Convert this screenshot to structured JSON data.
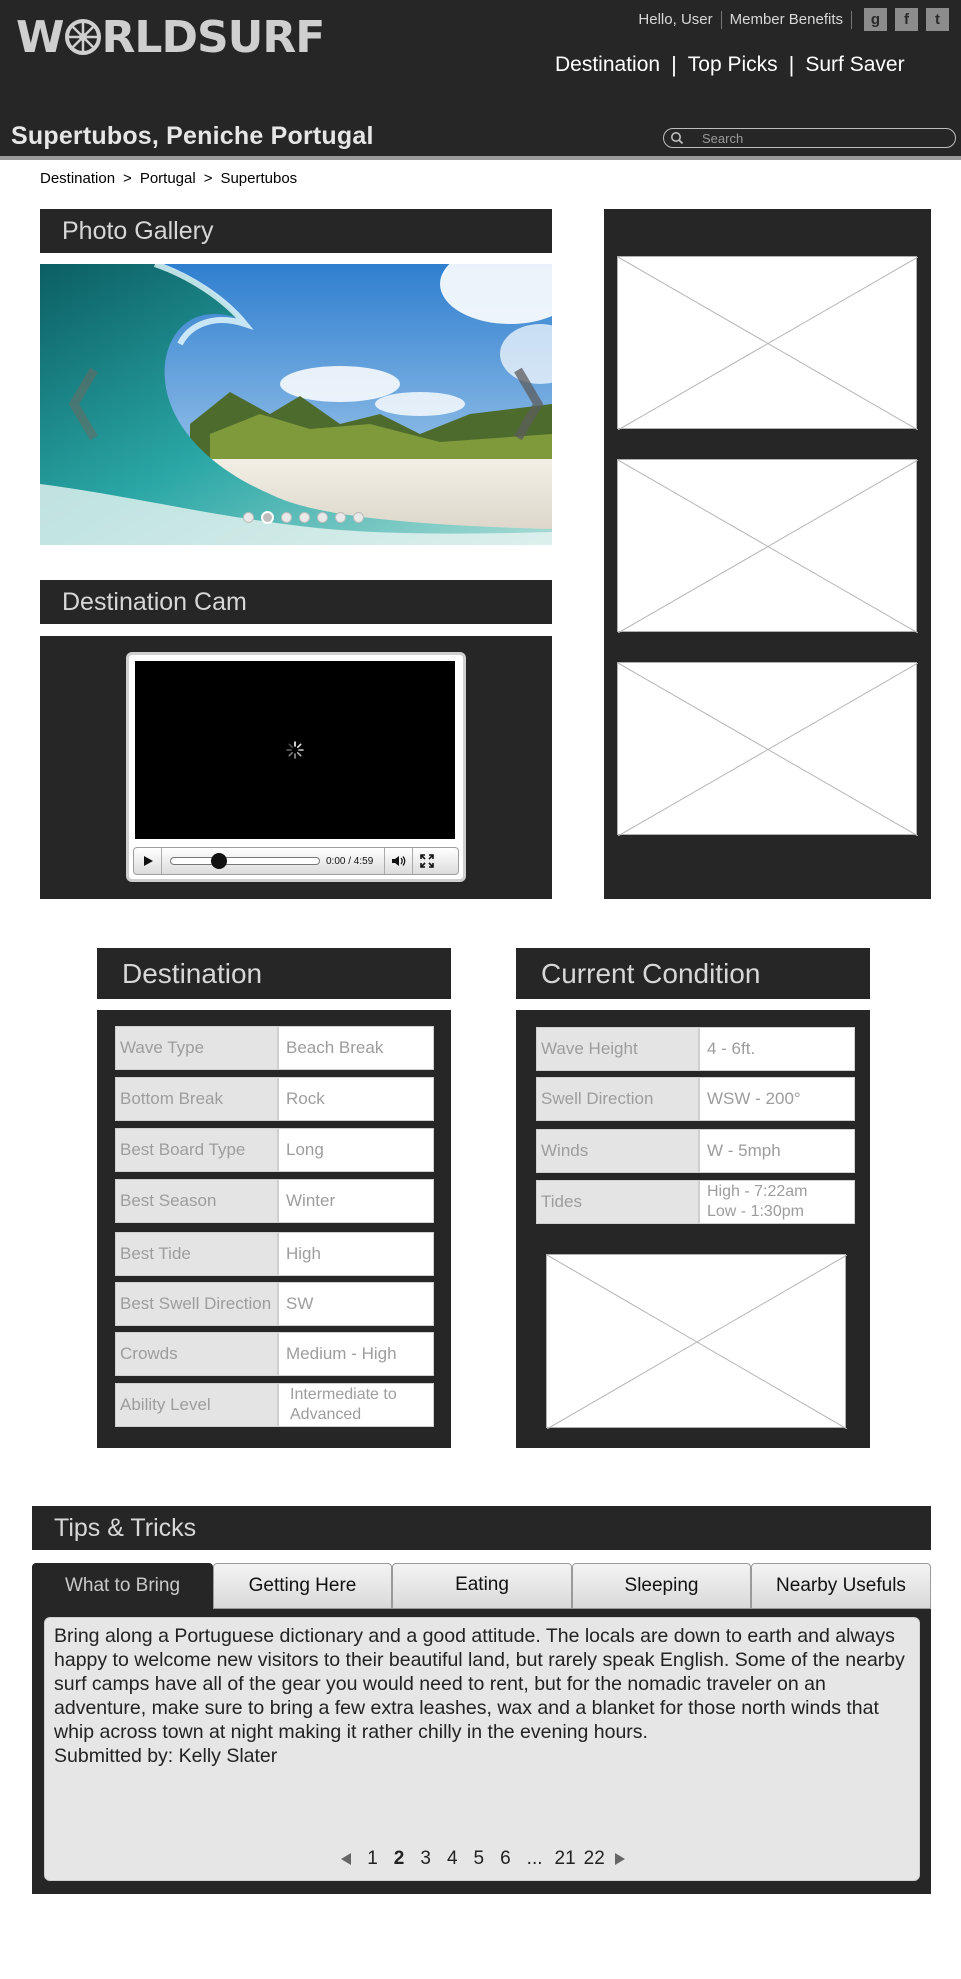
{
  "header": {
    "logo_text_left": "W",
    "logo_text_right": "RLDSURF",
    "greeting": "Hello, User",
    "member_benefits": "Member Benefits",
    "social": [
      "g",
      "f",
      "t"
    ],
    "nav": [
      "Destination",
      "Top Picks",
      "Surf Saver"
    ],
    "page_title": "Supertubos, Peniche Portugal",
    "search_placeholder": "Search"
  },
  "breadcrumb": [
    "Destination",
    ">",
    "Portugal",
    ">",
    "Supertubos"
  ],
  "gallery": {
    "title": "Photo Gallery",
    "dot_count": 7,
    "active_dot": 2
  },
  "cam": {
    "title": "Destination Cam",
    "time": "0:00 / 4:59"
  },
  "destination": {
    "title": "Destination",
    "rows": [
      {
        "label": "Wave Type",
        "value": "Beach Break"
      },
      {
        "label": "Bottom Break",
        "value": "Rock"
      },
      {
        "label": "Best Board Type",
        "value": "Long"
      },
      {
        "label": "Best Season",
        "value": "Winter"
      },
      {
        "label": "Best Tide",
        "value": "High"
      },
      {
        "label": "Best Swell Direction",
        "value": "SW"
      },
      {
        "label": "Crowds",
        "value": "Medium - High"
      },
      {
        "label": "Ability Level",
        "value": "Intermediate to Advanced"
      }
    ]
  },
  "conditions": {
    "title": "Current Condition",
    "rows": [
      {
        "label": "Wave Height",
        "value": "4 - 6ft."
      },
      {
        "label": "Swell Direction",
        "value": "WSW - 200°"
      },
      {
        "label": "Winds",
        "value": "W - 5mph"
      },
      {
        "label": "Tides",
        "value": "High - 7:22am\nLow - 1:30pm"
      }
    ]
  },
  "tips": {
    "title": "Tips & Tricks",
    "tabs": [
      "What to Bring",
      "Getting Here",
      "Eating",
      "Sleeping",
      "Nearby Usefuls"
    ],
    "active_tab": 0,
    "text": "Bring along a Portuguese dictionary and a good attitude. The locals are down to earth and always happy to welcome new visitors to their beautiful land, but rarely speak English. Some of the nearby surf camps have all of the gear you would need to rent, but for the nomadic traveler on an adventure, make sure to bring a few extra leashes, wax and a blanket for those north winds that whip across town at night making it rather chilly in the evening hours.",
    "submitted": "Submitted by: Kelly Slater",
    "pages": [
      "1",
      "2",
      "3",
      "4",
      "5",
      "6",
      "...",
      "21",
      "22"
    ],
    "current_page": "2"
  }
}
